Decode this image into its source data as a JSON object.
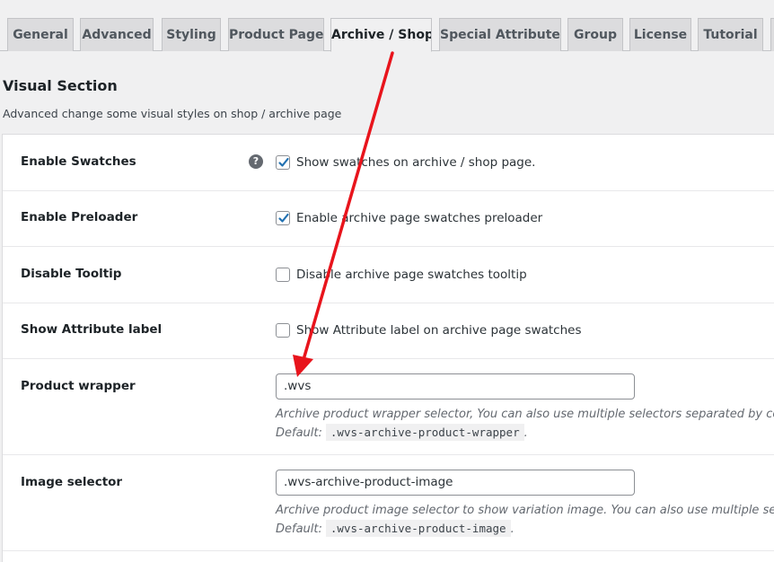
{
  "tabs": [
    {
      "label": "General"
    },
    {
      "label": "Advanced"
    },
    {
      "label": "Styling"
    },
    {
      "label": "Product Page"
    },
    {
      "label": "Archive / Shop"
    },
    {
      "label": "Special Attributes"
    },
    {
      "label": "Group"
    },
    {
      "label": "License"
    },
    {
      "label": "Tutorial"
    }
  ],
  "active_tab": "Archive / Shop",
  "section": {
    "title": "Visual Section",
    "description": "Advanced change some visual styles on shop / archive page"
  },
  "settings": [
    {
      "label": "Enable Swatches",
      "type": "checkbox",
      "checked": true,
      "text": "Show swatches on archive / shop page.",
      "has_help": true,
      "help_icon": "?"
    },
    {
      "label": "Enable Preloader",
      "type": "checkbox",
      "checked": true,
      "text": "Enable archive page swatches preloader"
    },
    {
      "label": "Disable Tooltip",
      "type": "checkbox",
      "checked": false,
      "text": "Disable archive page swatches tooltip"
    },
    {
      "label": "Show Attribute label",
      "type": "checkbox",
      "checked": false,
      "text": "Show Attribute label on archive page swatches"
    },
    {
      "label": "Product wrapper",
      "type": "text",
      "value": ".wvs",
      "description": "Archive product wrapper selector, You can also use multiple selectors separated by comm",
      "default_label": "Default:",
      "default_value": ".wvs-archive-product-wrapper",
      "default_suffix": "."
    },
    {
      "label": "Image selector",
      "type": "text",
      "value": ".wvs-archive-product-image",
      "description": "Archive product image selector to show variation image. You can also use multiple selecto",
      "default_label": "Default:",
      "default_value": ".wvs-archive-product-image",
      "default_suffix": "."
    }
  ],
  "colors": {
    "accent": "#2271b1",
    "annotation_arrow": "#e8141c",
    "background": "#f0f0f1",
    "panel": "#ffffff"
  }
}
